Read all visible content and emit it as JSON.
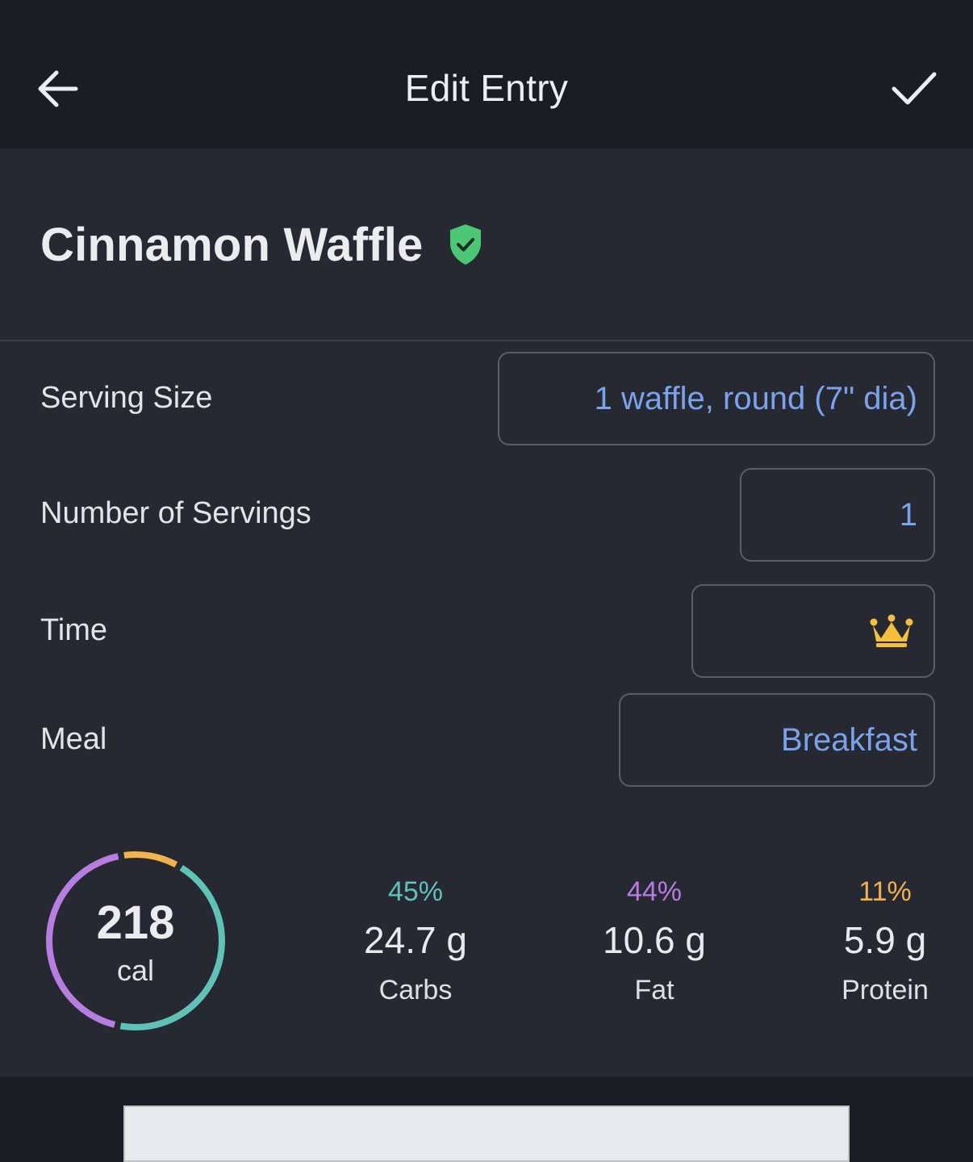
{
  "header": {
    "title": "Edit Entry",
    "back_icon": "arrow-left-icon",
    "confirm_icon": "checkmark-icon"
  },
  "food": {
    "name": "Cinnamon Waffle",
    "verified_icon": "verified-shield-icon",
    "verified_color": "#4cc775"
  },
  "fields": {
    "serving_size": {
      "label": "Serving Size",
      "value": "1 waffle, round (7\" dia)"
    },
    "servings": {
      "label": "Number of Servings",
      "value": "1"
    },
    "time": {
      "label": "Time",
      "icon": "premium-crown-icon"
    },
    "meal": {
      "label": "Meal",
      "value": "Breakfast"
    }
  },
  "summary": {
    "calories": "218",
    "calories_unit": "cal",
    "macros": [
      {
        "percent": "45%",
        "amount": "24.7 g",
        "name": "Carbs",
        "color": "#5ec2b7"
      },
      {
        "percent": "44%",
        "amount": "10.6 g",
        "name": "Fat",
        "color": "#b57ee0"
      },
      {
        "percent": "11%",
        "amount": "5.9 g",
        "name": "Protein",
        "color": "#f2b24e"
      }
    ]
  },
  "colors": {
    "accent_link": "#7ba3ec",
    "background_header": "#1b1d24",
    "background_content": "#262832"
  }
}
